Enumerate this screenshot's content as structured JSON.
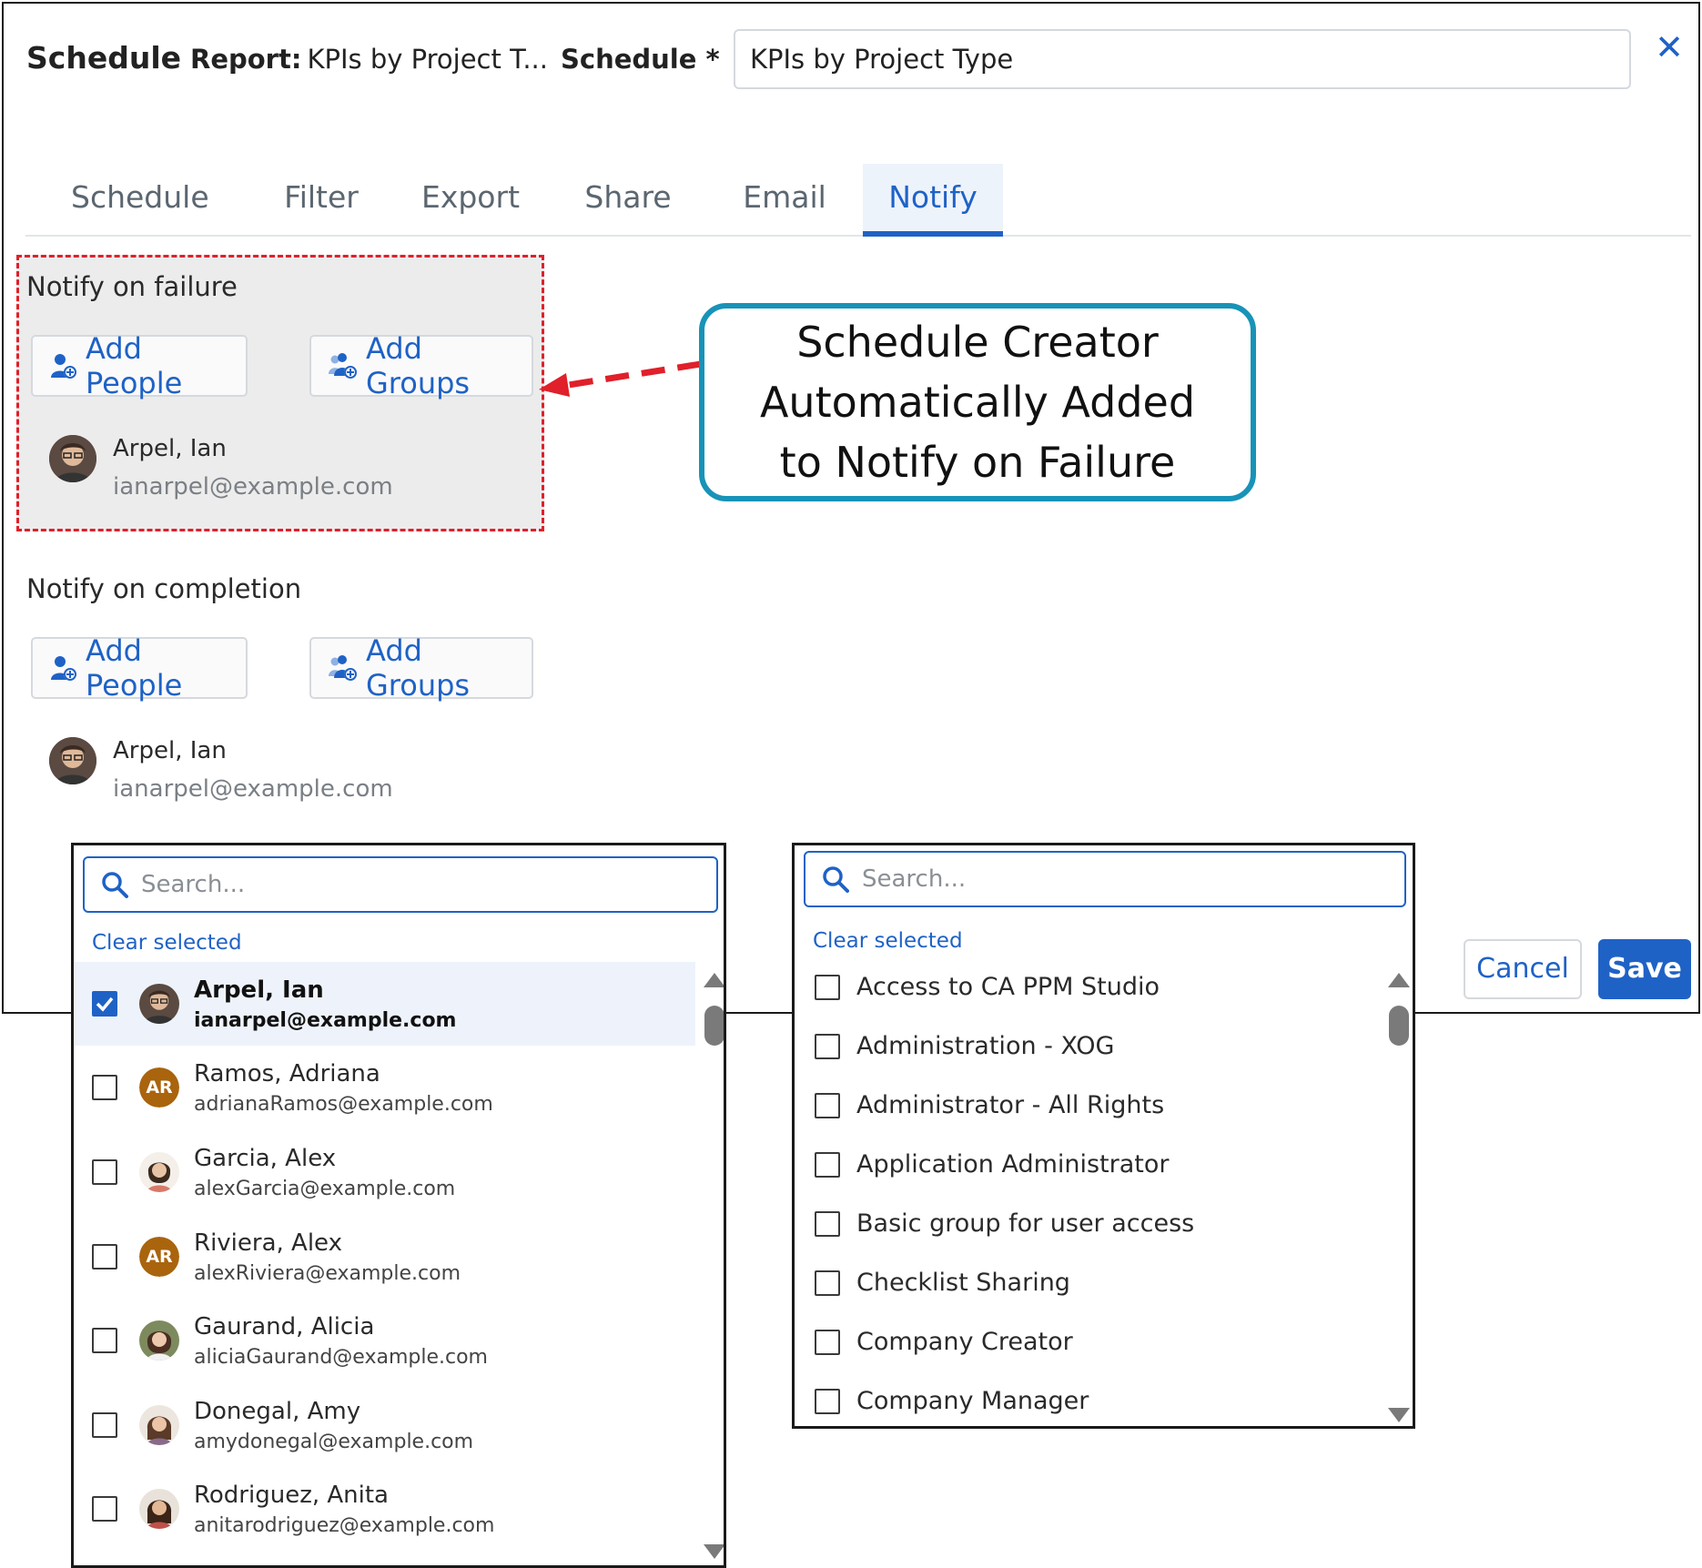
{
  "header": {
    "title": "Schedule",
    "report_label": "Report:",
    "report_value": "KPIs by Project T...",
    "schedule_label": "Schedule *",
    "schedule_name_value": "KPIs by Project Type"
  },
  "tabs": [
    {
      "label": "Schedule"
    },
    {
      "label": "Filter"
    },
    {
      "label": "Export"
    },
    {
      "label": "Share"
    },
    {
      "label": "Email"
    },
    {
      "label": "Notify",
      "active": true
    }
  ],
  "notify_failure": {
    "label": "Notify on failure",
    "add_people": "Add People",
    "add_groups": "Add Groups",
    "person": {
      "name": "Arpel, Ian",
      "email": "ianarpel@example.com"
    }
  },
  "notify_completion": {
    "label": "Notify on completion",
    "add_people": "Add People",
    "add_groups": "Add Groups",
    "person": {
      "name": "Arpel, Ian",
      "email": "ianarpel@example.com"
    }
  },
  "callout": {
    "line1": "Schedule Creator",
    "line2": "Automatically Added",
    "line3": "to Notify on Failure"
  },
  "footer": {
    "cancel": "Cancel",
    "save": "Save"
  },
  "people_picker": {
    "search_placeholder": "Search...",
    "clear_selected": "Clear selected",
    "people": [
      {
        "name": "Arpel, Ian",
        "email": "ianarpel@example.com",
        "checked": true,
        "avatar": "photo"
      },
      {
        "name": "Ramos, Adriana",
        "email": "adrianaRamos@example.com",
        "checked": false,
        "avatar": "initials",
        "initials": "AR"
      },
      {
        "name": "Garcia, Alex",
        "email": "alexGarcia@example.com",
        "checked": false,
        "avatar": "photo"
      },
      {
        "name": "Riviera, Alex",
        "email": "alexRiviera@example.com",
        "checked": false,
        "avatar": "initials",
        "initials": "AR"
      },
      {
        "name": "Gaurand, Alicia",
        "email": "aliciaGaurand@example.com",
        "checked": false,
        "avatar": "photo"
      },
      {
        "name": "Donegal, Amy",
        "email": "amydonegal@example.com",
        "checked": false,
        "avatar": "photo"
      },
      {
        "name": "Rodriguez, Anita",
        "email": "anitarodriguez@example.com",
        "checked": false,
        "avatar": "photo"
      }
    ]
  },
  "groups_picker": {
    "search_placeholder": "Search...",
    "clear_selected": "Clear selected",
    "groups": [
      {
        "name": "Access to CA PPM Studio"
      },
      {
        "name": "Administration - XOG"
      },
      {
        "name": "Administrator - All Rights"
      },
      {
        "name": "Application Administrator"
      },
      {
        "name": "Basic group for user access"
      },
      {
        "name": "Checklist Sharing"
      },
      {
        "name": "Company Creator"
      },
      {
        "name": "Company Manager"
      }
    ]
  },
  "colors": {
    "accent": "#1f62c6",
    "callout_border": "#1893b8",
    "annotation_red": "#e0202a",
    "initials_bg": "#a9640d"
  }
}
